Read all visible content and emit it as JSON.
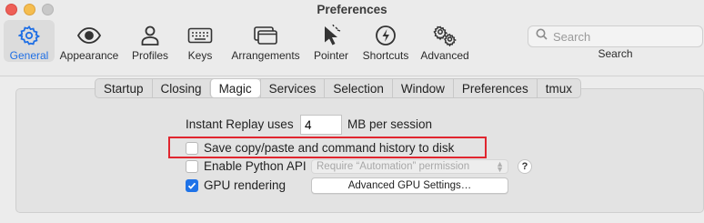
{
  "window": {
    "title": "Preferences"
  },
  "toolbar": {
    "items": [
      {
        "label": "General",
        "icon": "gear-icon",
        "selected": true
      },
      {
        "label": "Appearance",
        "icon": "eye-icon"
      },
      {
        "label": "Profiles",
        "icon": "person-icon"
      },
      {
        "label": "Keys",
        "icon": "keyboard-icon"
      },
      {
        "label": "Arrangements",
        "icon": "windows-icon"
      },
      {
        "label": "Pointer",
        "icon": "cursor-icon"
      },
      {
        "label": "Shortcuts",
        "icon": "lightning-icon"
      },
      {
        "label": "Advanced",
        "icon": "gears-icon"
      }
    ],
    "accent_color": "#1f6fe5"
  },
  "search": {
    "placeholder": "Search",
    "label": "Search"
  },
  "tabs": [
    {
      "label": "Startup"
    },
    {
      "label": "Closing"
    },
    {
      "label": "Magic",
      "active": true
    },
    {
      "label": "Services"
    },
    {
      "label": "Selection"
    },
    {
      "label": "Window"
    },
    {
      "label": "Preferences"
    },
    {
      "label": "tmux"
    }
  ],
  "magic": {
    "instant_replay_label": "Instant Replay uses",
    "instant_replay_value": "4",
    "instant_replay_unit": "MB per session",
    "save_history_label": "Save copy/paste and command history to disk",
    "save_history_checked": false,
    "python_api_label": "Enable Python API",
    "python_api_checked": false,
    "python_api_permission": "Require “Automation” permission",
    "help_label": "?",
    "gpu_label": "GPU rendering",
    "gpu_checked": true,
    "gpu_button_label": "Advanced GPU Settings…"
  },
  "highlight_color": "#e0262f"
}
